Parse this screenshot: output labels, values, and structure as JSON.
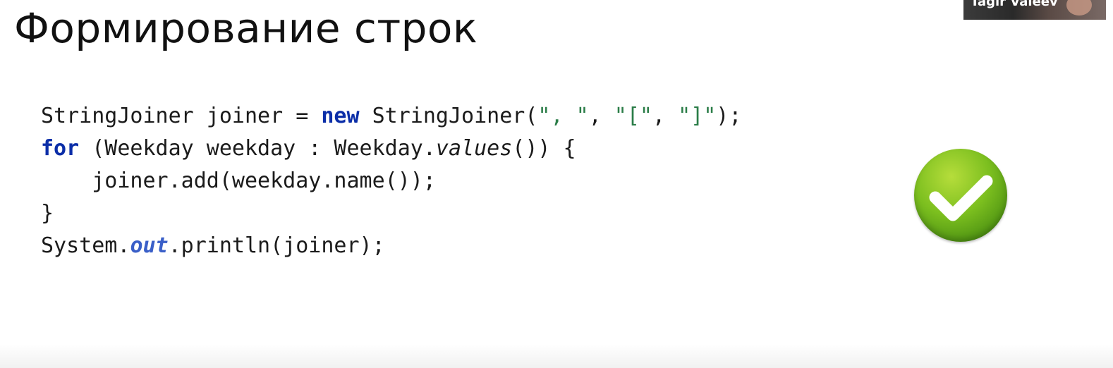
{
  "slide": {
    "title": "Формирование строк",
    "code": {
      "line1": {
        "a": "StringJoiner joiner = ",
        "kw": "new",
        "b": " StringJoiner(",
        "s1": "\", \"",
        "c": ", ",
        "s2": "\"[\"",
        "d": ", ",
        "s3": "\"]\"",
        "e": ");"
      },
      "line2": {
        "kw": "for",
        "a": " (Weekday weekday : Weekday.",
        "method": "values",
        "b": "()) {"
      },
      "line3": "    joiner.add(weekday.name());",
      "line4": "}",
      "line5": {
        "a": "System.",
        "field": "out",
        "b": ".println(joiner);"
      }
    },
    "badge_icon": "check-icon",
    "accent_color": "#7cbf1f"
  },
  "webcam": {
    "name": "Tagir Valeev"
  }
}
